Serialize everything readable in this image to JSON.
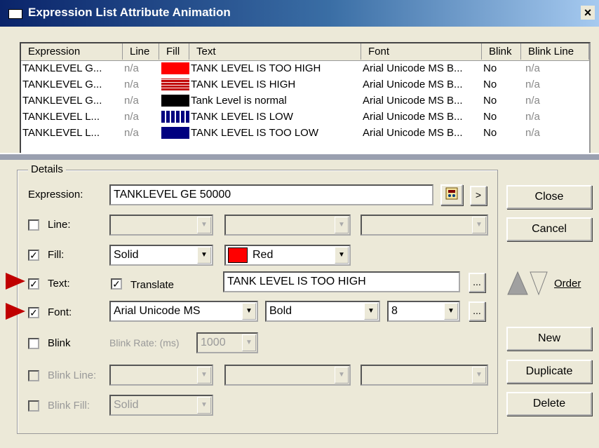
{
  "window": {
    "title": "Expression List Attribute Animation",
    "close_glyph": "×"
  },
  "list": {
    "columns": [
      "Expression",
      "Line",
      "Fill",
      "Text",
      "Font",
      "Blink",
      "Blink Line"
    ],
    "rows": [
      {
        "expression": "TANKLEVEL G...",
        "line": "n/a",
        "fill_color": "#ff0000",
        "fill_pattern": "solid",
        "text": "TANK LEVEL IS TOO HIGH",
        "font": "Arial Unicode MS  B...",
        "blink": "No",
        "blink_line": "n/a"
      },
      {
        "expression": "TANKLEVEL G...",
        "line": "n/a",
        "fill_color": "#c00000",
        "fill_pattern": "horizontal",
        "text": "TANK LEVEL IS HIGH",
        "font": "Arial Unicode MS  B...",
        "blink": "No",
        "blink_line": "n/a"
      },
      {
        "expression": "TANKLEVEL G...",
        "line": "n/a",
        "fill_color": "#000000",
        "fill_pattern": "solid",
        "text": "Tank Level is normal",
        "font": "Arial Unicode MS  B...",
        "blink": "No",
        "blink_line": "n/a"
      },
      {
        "expression": "TANKLEVEL L...",
        "line": "n/a",
        "fill_color": "#000080",
        "fill_pattern": "vertical",
        "text": "TANK LEVEL IS LOW",
        "font": "Arial Unicode MS  B...",
        "blink": "No",
        "blink_line": "n/a"
      },
      {
        "expression": "TANKLEVEL L...",
        "line": "n/a",
        "fill_color": "#000080",
        "fill_pattern": "solid",
        "text": "TANK LEVEL IS TOO LOW",
        "font": "Arial Unicode MS  B...",
        "blink": "No",
        "blink_line": "n/a"
      }
    ]
  },
  "details": {
    "legend": "Details",
    "expression_label": "Expression:",
    "expression_value": "TANKLEVEL GE 50000",
    "expr_browse_icon": "expression-editor-icon",
    "expr_arrow": ">",
    "line_label": "Line:",
    "line_checked": false,
    "fill_label": "Fill:",
    "fill_checked": true,
    "fill_style": "Solid",
    "fill_color_name": "Red",
    "fill_color": "#ff0000",
    "text_label": "Text:",
    "text_checked": true,
    "translate_label": "Translate",
    "translate_checked": true,
    "text_value": "TANK LEVEL IS TOO HIGH",
    "ellipsis": "...",
    "font_label": "Font:",
    "font_checked": true,
    "font_name": "Arial Unicode MS",
    "font_style": "Bold",
    "font_size": "8",
    "blink_label": "Blink",
    "blink_checked": false,
    "blink_rate_label": "Blink Rate: (ms)",
    "blink_rate_value": "1000",
    "blink_line_label": "Blink Line:",
    "blink_fill_label": "Blink Fill:",
    "blink_fill_value": "Solid"
  },
  "buttons": {
    "close": "Close",
    "cancel": "Cancel",
    "order": "Order",
    "new": "New",
    "duplicate": "Duplicate",
    "delete": "Delete"
  },
  "check_glyph": "✓",
  "combo_arrow": "▼"
}
